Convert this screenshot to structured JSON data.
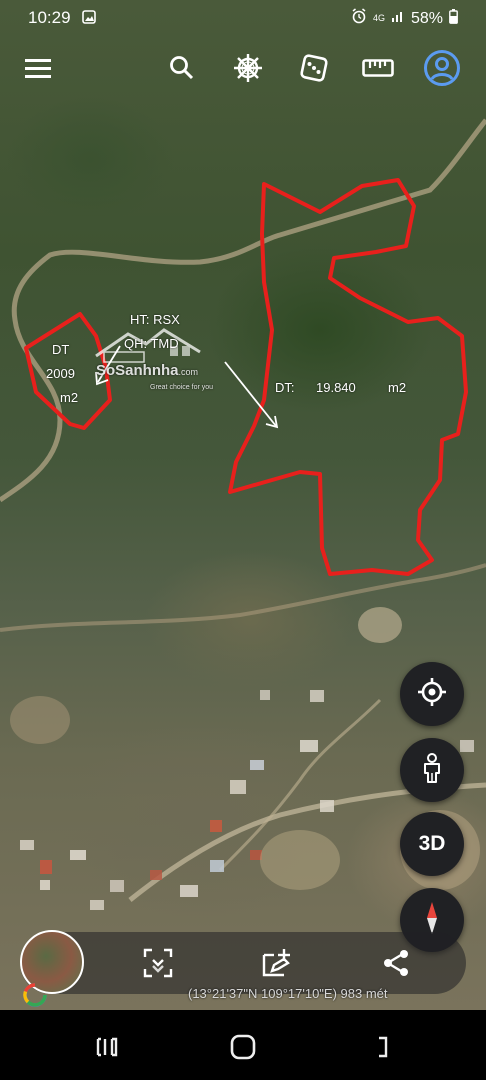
{
  "status_bar": {
    "time": "10:29",
    "network": "4G",
    "battery": "58%"
  },
  "toolbar": {
    "menu_icon": "menu-icon",
    "search_icon": "search-icon",
    "voyager_icon": "ship-wheel-icon",
    "feeling_lucky_icon": "dice-icon",
    "measure_icon": "ruler-icon",
    "account_icon": "account-icon"
  },
  "map_overlay": {
    "left_parcel": {
      "line1": "DT",
      "line2": "2009",
      "line3": "m2"
    },
    "watermark": {
      "ht": "HT: RSX",
      "qh": "QH: TMD",
      "brand": "SoSanhnha",
      "brand_suffix": ".com",
      "tagline": "Great choice for you"
    },
    "right_parcel": {
      "label": "DT:",
      "value": "19.840",
      "unit": "m2"
    },
    "outline_color": "#e8201c"
  },
  "side_buttons": {
    "my_location_icon": "my-location-icon",
    "street_view_icon": "pegman-icon",
    "three_d_label": "3D",
    "compass_icon": "compass-icon"
  },
  "bottom_bar": {
    "expand_icon": "expand-icon",
    "add_feature_icon": "add-feature-icon",
    "share_icon": "share-icon",
    "coordinates": "(13°21'37\"N 109°17'10\"E) 983 mét"
  },
  "nav_bar": {
    "recents_icon": "recents-icon",
    "home_icon": "home-icon",
    "back_icon": "back-icon"
  }
}
